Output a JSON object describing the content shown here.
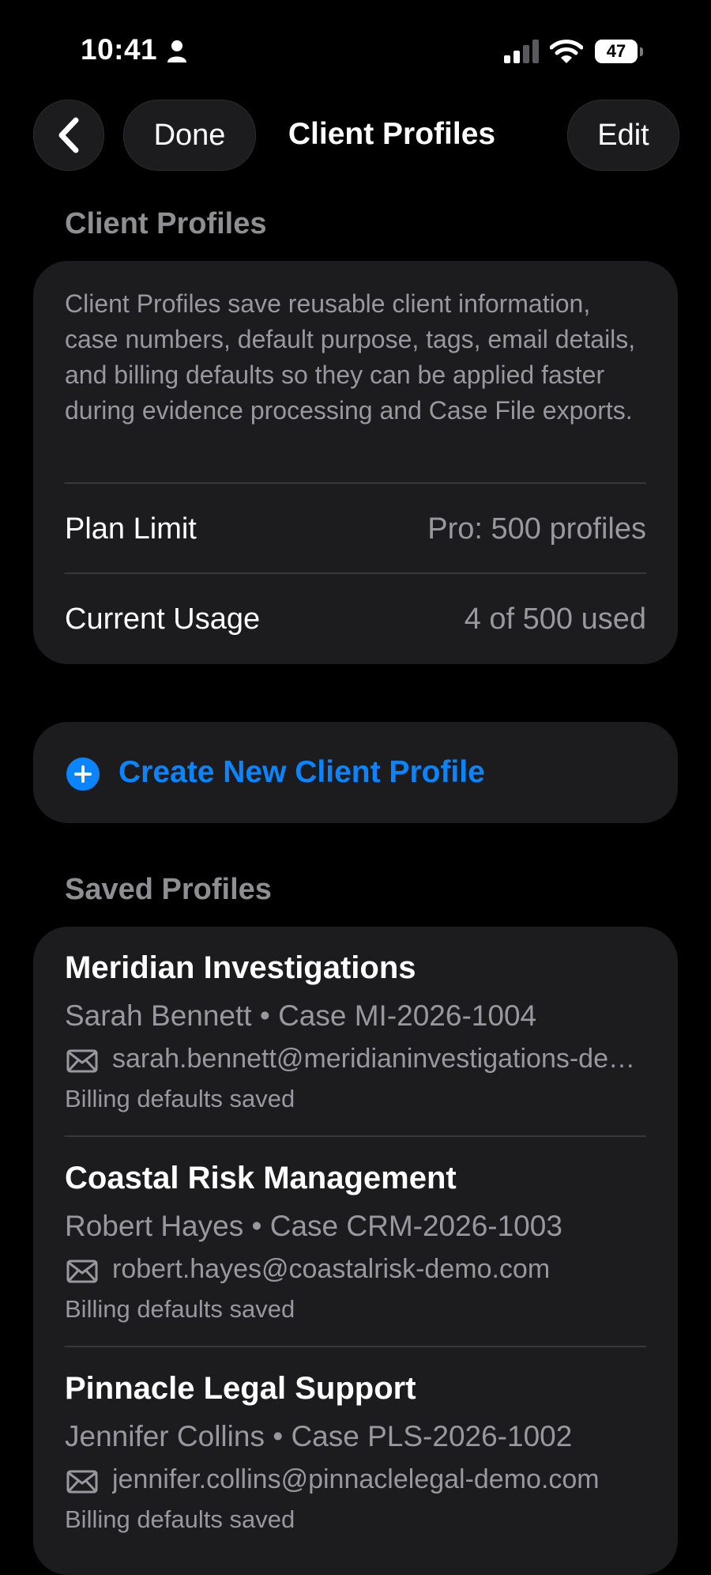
{
  "status": {
    "time": "10:41",
    "battery": "47"
  },
  "nav": {
    "done_label": "Done",
    "title": "Client Profiles",
    "edit_label": "Edit"
  },
  "info": {
    "header": "Client Profiles",
    "description": "Client Profiles save reusable client information, case numbers, default purpose, tags, email details, and billing defaults so they can be applied faster during evidence processing and Case File exports.",
    "rows": [
      {
        "label": "Plan Limit",
        "value": "Pro: 500 profiles"
      },
      {
        "label": "Current Usage",
        "value": "4 of 500 used"
      }
    ]
  },
  "create": {
    "label": "Create New Client Profile",
    "accent": "#0a84ff"
  },
  "saved": {
    "header": "Saved Profiles",
    "profiles": [
      {
        "name": "Meridian Investigations",
        "subtitle": "Sarah Bennett • Case MI-2026-1004",
        "email": "sarah.bennett@meridianinvestigations-demo.com",
        "billing": "Billing defaults saved"
      },
      {
        "name": "Coastal Risk Management",
        "subtitle": "Robert Hayes • Case CRM-2026-1003",
        "email": "robert.hayes@coastalrisk-demo.com",
        "billing": "Billing defaults saved"
      },
      {
        "name": "Pinnacle Legal Support",
        "subtitle": "Jennifer Collins • Case PLS-2026-1002",
        "email": "jennifer.collins@pinnaclelegal-demo.com",
        "billing": "Billing defaults saved"
      }
    ]
  }
}
